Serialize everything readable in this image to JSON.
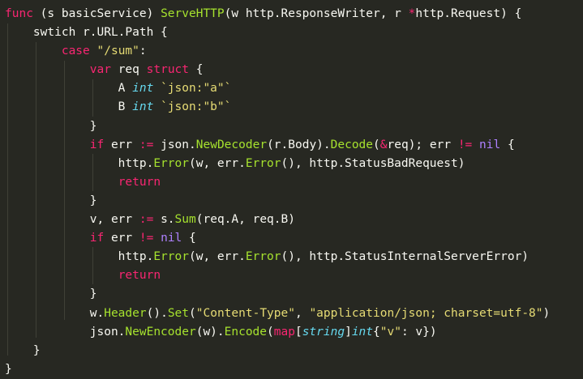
{
  "editor": {
    "theme_colors": {
      "background": "#272822",
      "keyword": "#f92672",
      "function": "#a6e22e",
      "type": "#66d9ef",
      "string": "#e6db74",
      "constant": "#ae81ff",
      "text": "#f8f8f2"
    },
    "lines": [
      [
        {
          "text": "func",
          "kind": "k"
        },
        {
          "text": " (s basicService) ",
          "kind": "p"
        },
        {
          "text": "ServeHTTP",
          "kind": "f"
        },
        {
          "text": "(w http.ResponseWriter, r ",
          "kind": "p"
        },
        {
          "text": "*",
          "kind": "k"
        },
        {
          "text": "http.Request) {",
          "kind": "p"
        }
      ],
      [
        {
          "text": "    swtich r.URL.Path {",
          "kind": "p"
        }
      ],
      [
        {
          "text": "        ",
          "kind": "p"
        },
        {
          "text": "case",
          "kind": "k"
        },
        {
          "text": " ",
          "kind": "p"
        },
        {
          "text": "\"/sum\"",
          "kind": "s"
        },
        {
          "text": ":",
          "kind": "p"
        }
      ],
      [
        {
          "text": "            ",
          "kind": "p"
        },
        {
          "text": "var",
          "kind": "k"
        },
        {
          "text": " req ",
          "kind": "p"
        },
        {
          "text": "struct",
          "kind": "k"
        },
        {
          "text": " {",
          "kind": "p"
        }
      ],
      [
        {
          "text": "                A ",
          "kind": "p"
        },
        {
          "text": "int",
          "kind": "t"
        },
        {
          "text": " ",
          "kind": "p"
        },
        {
          "text": "`json:\"a\"`",
          "kind": "s"
        }
      ],
      [
        {
          "text": "                B ",
          "kind": "p"
        },
        {
          "text": "int",
          "kind": "t"
        },
        {
          "text": " ",
          "kind": "p"
        },
        {
          "text": "`json:\"b\"`",
          "kind": "s"
        }
      ],
      [
        {
          "text": "            }",
          "kind": "p"
        }
      ],
      [
        {
          "text": "            ",
          "kind": "p"
        },
        {
          "text": "if",
          "kind": "k"
        },
        {
          "text": " err ",
          "kind": "p"
        },
        {
          "text": ":=",
          "kind": "k"
        },
        {
          "text": " json.",
          "kind": "p"
        },
        {
          "text": "NewDecoder",
          "kind": "f"
        },
        {
          "text": "(r.Body).",
          "kind": "p"
        },
        {
          "text": "Decode",
          "kind": "f"
        },
        {
          "text": "(",
          "kind": "p"
        },
        {
          "text": "&",
          "kind": "k"
        },
        {
          "text": "req); err ",
          "kind": "p"
        },
        {
          "text": "!=",
          "kind": "k"
        },
        {
          "text": " ",
          "kind": "p"
        },
        {
          "text": "nil",
          "kind": "c"
        },
        {
          "text": " {",
          "kind": "p"
        }
      ],
      [
        {
          "text": "                http.",
          "kind": "p"
        },
        {
          "text": "Error",
          "kind": "f"
        },
        {
          "text": "(w, err.",
          "kind": "p"
        },
        {
          "text": "Error",
          "kind": "f"
        },
        {
          "text": "(), http.StatusBadRequest)",
          "kind": "p"
        }
      ],
      [
        {
          "text": "                ",
          "kind": "p"
        },
        {
          "text": "return",
          "kind": "k"
        }
      ],
      [
        {
          "text": "            }",
          "kind": "p"
        }
      ],
      [
        {
          "text": "            v, err ",
          "kind": "p"
        },
        {
          "text": ":=",
          "kind": "k"
        },
        {
          "text": " s.",
          "kind": "p"
        },
        {
          "text": "Sum",
          "kind": "f"
        },
        {
          "text": "(req.A, req.B)",
          "kind": "p"
        }
      ],
      [
        {
          "text": "            ",
          "kind": "p"
        },
        {
          "text": "if",
          "kind": "k"
        },
        {
          "text": " err ",
          "kind": "p"
        },
        {
          "text": "!=",
          "kind": "k"
        },
        {
          "text": " ",
          "kind": "p"
        },
        {
          "text": "nil",
          "kind": "c"
        },
        {
          "text": " {",
          "kind": "p"
        }
      ],
      [
        {
          "text": "                http.",
          "kind": "p"
        },
        {
          "text": "Error",
          "kind": "f"
        },
        {
          "text": "(w, err.",
          "kind": "p"
        },
        {
          "text": "Error",
          "kind": "f"
        },
        {
          "text": "(), http.StatusInternalServerError)",
          "kind": "p"
        }
      ],
      [
        {
          "text": "                ",
          "kind": "p"
        },
        {
          "text": "return",
          "kind": "k"
        }
      ],
      [
        {
          "text": "            }",
          "kind": "p"
        }
      ],
      [
        {
          "text": "            w.",
          "kind": "p"
        },
        {
          "text": "Header",
          "kind": "f"
        },
        {
          "text": "().",
          "kind": "p"
        },
        {
          "text": "Set",
          "kind": "f"
        },
        {
          "text": "(",
          "kind": "p"
        },
        {
          "text": "\"Content-Type\"",
          "kind": "s"
        },
        {
          "text": ", ",
          "kind": "p"
        },
        {
          "text": "\"application/json; charset=utf-8\"",
          "kind": "s"
        },
        {
          "text": ")",
          "kind": "p"
        }
      ],
      [
        {
          "text": "            json.",
          "kind": "p"
        },
        {
          "text": "NewEncoder",
          "kind": "f"
        },
        {
          "text": "(w).",
          "kind": "p"
        },
        {
          "text": "Encode",
          "kind": "f"
        },
        {
          "text": "(",
          "kind": "p"
        },
        {
          "text": "map",
          "kind": "k"
        },
        {
          "text": "[",
          "kind": "p"
        },
        {
          "text": "string",
          "kind": "t"
        },
        {
          "text": "]",
          "kind": "p"
        },
        {
          "text": "int",
          "kind": "t"
        },
        {
          "text": "{",
          "kind": "p"
        },
        {
          "text": "\"v\"",
          "kind": "s"
        },
        {
          "text": ": v})",
          "kind": "p"
        }
      ],
      [
        {
          "text": "    }",
          "kind": "p"
        }
      ],
      [
        {
          "text": "}",
          "kind": "p"
        }
      ]
    ]
  }
}
